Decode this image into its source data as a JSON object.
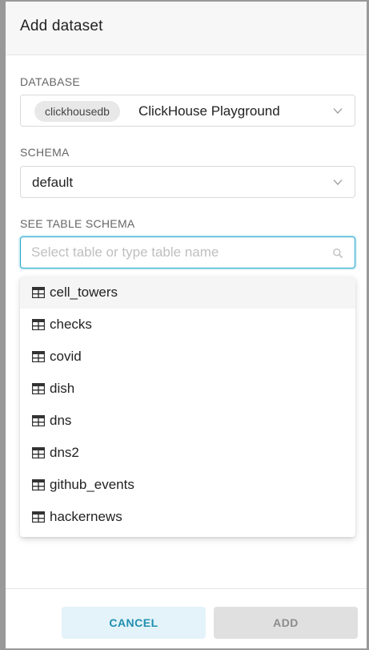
{
  "modal": {
    "title": "Add dataset"
  },
  "database": {
    "label": "DATABASE",
    "badge": "clickhousedb",
    "value": "ClickHouse Playground"
  },
  "schema": {
    "label": "SCHEMA",
    "value": "default"
  },
  "table": {
    "label": "SEE TABLE SCHEMA",
    "placeholder": "Select table or type table name",
    "options": [
      {
        "label": "cell_towers"
      },
      {
        "label": "checks"
      },
      {
        "label": "covid"
      },
      {
        "label": "dish"
      },
      {
        "label": "dns"
      },
      {
        "label": "dns2"
      },
      {
        "label": "github_events"
      },
      {
        "label": "hackernews"
      }
    ],
    "active_index": 0
  },
  "footer": {
    "cancel_label": "CANCEL",
    "add_label": "ADD"
  },
  "colors": {
    "accent": "#20a7c9",
    "cancel_bg": "#e3f3f9",
    "cancel_text": "#1f8fb0",
    "add_bg": "#e0e0e0",
    "add_text": "#8c8c8c"
  },
  "icons": {
    "select_chevron": "chevron-down-icon",
    "search": "search-icon",
    "table": "table-icon"
  }
}
